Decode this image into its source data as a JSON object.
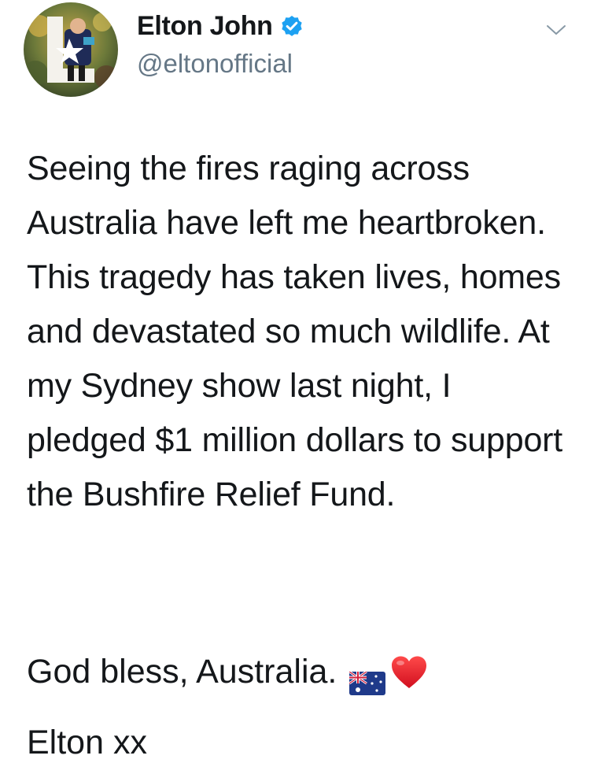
{
  "tweet": {
    "author": {
      "display_name": "Elton John",
      "handle": "@eltonofficial",
      "verified": true,
      "avatar_icon": "album-art-avatar",
      "verified_icon": "verified-badge-icon",
      "verified_color": "#1da1f2"
    },
    "menu_icon": "chevron-down-icon",
    "body": "Seeing the fires raging across Australia have left me heartbroken. This tragedy has taken lives, homes and devastated so much wildlife. At my Sydney show last night, I pledged $1 million dollars to support the Bushfire Relief Fund.",
    "blessing": "God bless, Australia.",
    "emojis": [
      "australian-flag-emoji",
      "red-heart-emoji"
    ],
    "signoff": "Elton xx",
    "colors": {
      "text": "#14171a",
      "secondary_text": "#657786",
      "background": "#ffffff"
    }
  }
}
